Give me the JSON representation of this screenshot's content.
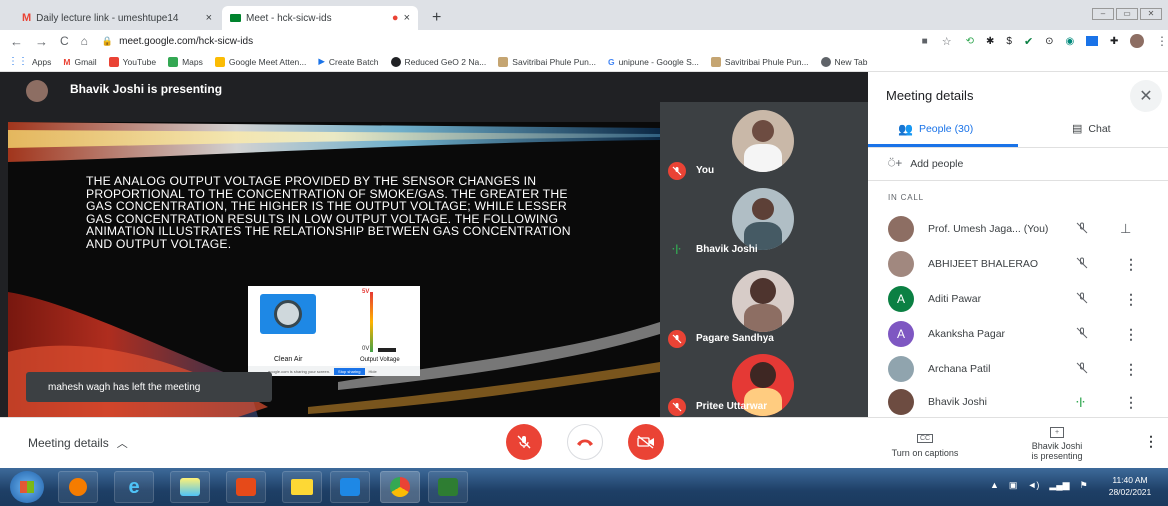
{
  "browser": {
    "tabs": [
      {
        "title": "Daily lecture link - umeshtupe14",
        "active": false
      },
      {
        "title": "Meet - hck-sicw-ids",
        "active": true
      }
    ],
    "new_tab": "+",
    "url": "meet.google.com/hck-sicw-ids",
    "bookmarks": [
      "Apps",
      "Gmail",
      "YouTube",
      "Maps",
      "Google Meet Atten...",
      "Create Batch",
      "Reduced GeO 2 Na...",
      "Savitribai Phule Pun...",
      "unipune - Google S...",
      "Savitribai Phule Pun...",
      "New Tab"
    ]
  },
  "meet": {
    "presenter_banner": "Bhavik Joshi is presenting",
    "slide": {
      "text": "THE ANALOG OUTPUT VOLTAGE PROVIDED BY THE SENSOR CHANGES IN PROPORTIONAL TO THE CONCENTRATION OF SMOKE/GAS. THE GREATER THE GAS CONCENTRATION, THE HIGHER IS THE OUTPUT VOLTAGE; WHILE LESSER GAS CONCENTRATION RESULTS IN LOW OUTPUT VOLTAGE. THE FOLLOWING ANIMATION ILLUSTRATES THE RELATIONSHIP BETWEEN GAS CONCENTRATION AND OUTPUT VOLTAGE.",
      "figure_clean_air": "Clean Air",
      "figure_output_voltage": "Output Voltage",
      "figure_5v": "5V",
      "figure_0v": "0V",
      "sharing_note": "google.com is sharing your screen.",
      "stop_sharing": "Stop sharing",
      "hide": "Hide"
    },
    "toast": "mahesh wagh has left the meeting",
    "tiles": [
      {
        "name": "You",
        "muted": true
      },
      {
        "name": "Bhavik Joshi",
        "muted": false
      },
      {
        "name": "Pagare Sandhya",
        "muted": true
      },
      {
        "name": "Pritee Uttarwar",
        "muted": true
      }
    ]
  },
  "panel": {
    "title": "Meeting details",
    "tab_people": "People (30)",
    "tab_chat": "Chat",
    "add_people": "Add people",
    "in_call": "IN CALL",
    "participants": [
      {
        "name": "Prof. Umesh Jaga...",
        "suffix": "(You)",
        "initial": "",
        "color": "#8d6e63"
      },
      {
        "name": "ABHIJEET BHALERAO",
        "suffix": "",
        "initial": "",
        "color": "#a1887f"
      },
      {
        "name": "Aditi Pawar",
        "suffix": "",
        "initial": "A",
        "color": "#0b8043"
      },
      {
        "name": "Akanksha Pagar",
        "suffix": "",
        "initial": "A",
        "color": "#7e57c2"
      },
      {
        "name": "Archana Patil",
        "suffix": "",
        "initial": "",
        "color": "#90a4ae"
      },
      {
        "name": "Bhavik Joshi",
        "suffix": "",
        "initial": "",
        "color": "#6d4c41"
      }
    ]
  },
  "bottom": {
    "meeting_details": "Meeting details",
    "captions_label": "Turn on captions",
    "cc": "CC",
    "presenting_line1": "Bhavik Joshi",
    "presenting_line2": "is presenting"
  },
  "taskbar": {
    "time": "11:40 AM",
    "date": "28/02/2021"
  },
  "colors": {
    "red": "#ea4335",
    "meet_dark": "#202124",
    "tile_bg": "#3c4043",
    "accent": "#1a73e8",
    "green_speaking": "#34a853"
  }
}
